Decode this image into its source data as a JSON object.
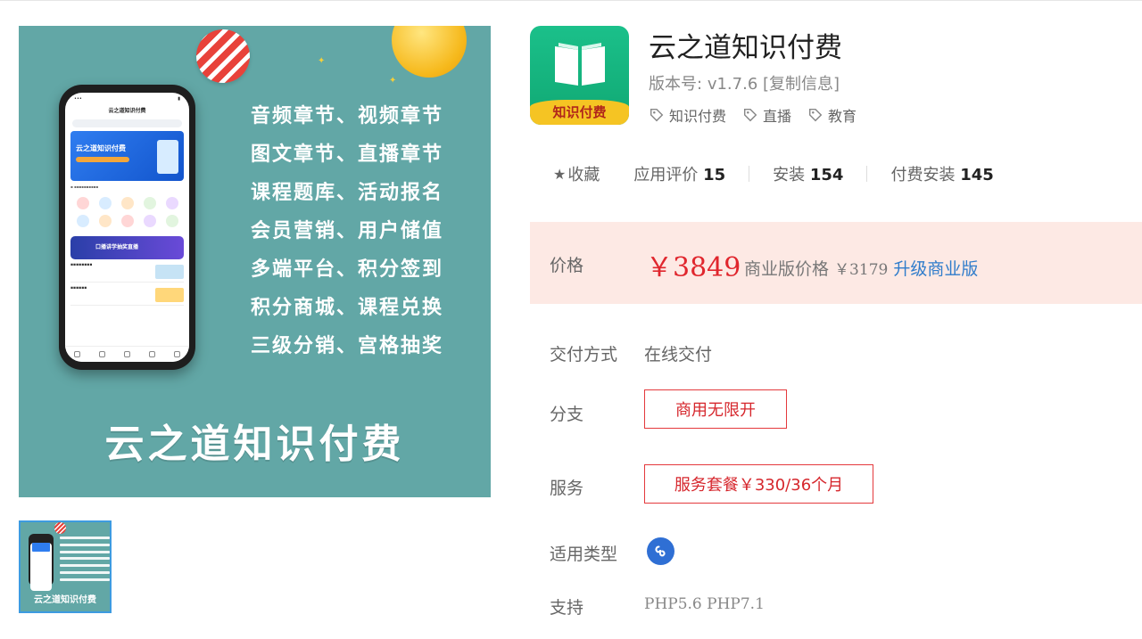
{
  "gallery": {
    "main_image": {
      "feature_lines": [
        "音频章节、视频章节",
        "图文章节、直播章节",
        "课程题库、活动报名",
        "会员营销、用户储值",
        "多端平台、积分签到",
        "积分商城、课程兑换",
        "三级分销、宫格抽奖"
      ],
      "banner_title": "云之道知识付费",
      "phone_header": "云之道知识付费",
      "phone_banner": "云之道知识付费",
      "phone_live": "口播讲学抽奖直播"
    },
    "thumbnail": {
      "title": "云之道知识付费"
    }
  },
  "app": {
    "icon_label": "知识付费",
    "title": "云之道知识付费",
    "version_label": "版本号:",
    "version": "v1.7.6",
    "copy_info": "[复制信息]",
    "tags": [
      "知识付费",
      "直播",
      "教育"
    ]
  },
  "stats": {
    "favorite_label": "收藏",
    "reviews_label": "应用评价",
    "reviews": "15",
    "installs_label": "安装",
    "installs": "154",
    "paid_installs_label": "付费安装",
    "paid_installs": "145"
  },
  "price": {
    "label": "价格",
    "main": "￥3849",
    "business_label": "商业版价格",
    "business_price": "￥3179",
    "upgrade": "升级商业版"
  },
  "details": {
    "delivery_label": "交付方式",
    "delivery_value": "在线交付",
    "branch_label": "分支",
    "branch_value": "商用无限开",
    "service_label": "服务",
    "service_value": "服务套餐￥330/36个月",
    "type_label": "适用类型",
    "type_icon": "mini-program-icon",
    "support_label": "支持",
    "support_value": "PHP5.6 PHP7.1"
  },
  "colors": {
    "price_red": "#e0262d",
    "price_bg": "#fde9e4",
    "link_blue": "#2f7ccb",
    "banner_teal": "#62a7a6",
    "icon_green": "#10a873"
  }
}
